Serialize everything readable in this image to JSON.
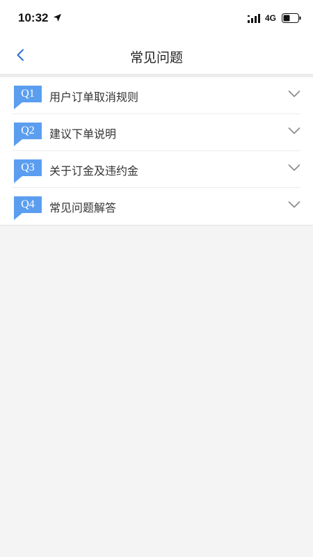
{
  "status_bar": {
    "time": "10:32",
    "network": "4G",
    "icons": [
      "location-arrow-icon",
      "signal-bars-icon",
      "battery-icon"
    ]
  },
  "nav": {
    "title": "常见问题",
    "back_icon": "chevron-left-icon"
  },
  "faq": {
    "items": [
      {
        "badge": "Q1",
        "label": "用户订单取消规则"
      },
      {
        "badge": "Q2",
        "label": "建议下单说明"
      },
      {
        "badge": "Q3",
        "label": "关于订金及违约金"
      },
      {
        "badge": "Q4",
        "label": "常见问题解答"
      }
    ],
    "expand_icon": "chevron-down-icon"
  },
  "colors": {
    "accent": "#5b9ef0",
    "background": "#f4f4f4",
    "card": "#ffffff",
    "text": "#333333",
    "back_icon": "#2e6fcf"
  }
}
